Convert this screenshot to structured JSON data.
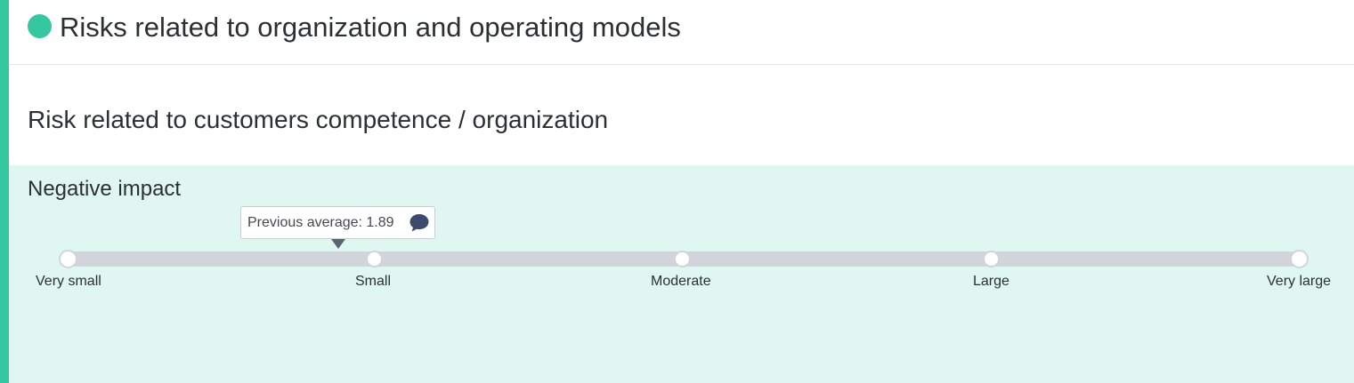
{
  "section": {
    "title": "Risks related to organization and operating models",
    "status_color": "#35c79f"
  },
  "question": {
    "title": "Risk related to customers competence / organization"
  },
  "impact": {
    "title": "Negative impact",
    "background": "#e0f6f0",
    "previous_average_text": "Previous average: 1.89",
    "previous_average_value": 1.89,
    "comment_icon": "comment-icon",
    "scale": [
      "Very small",
      "Small",
      "Moderate",
      "Large",
      "Very large"
    ],
    "selected": null
  }
}
